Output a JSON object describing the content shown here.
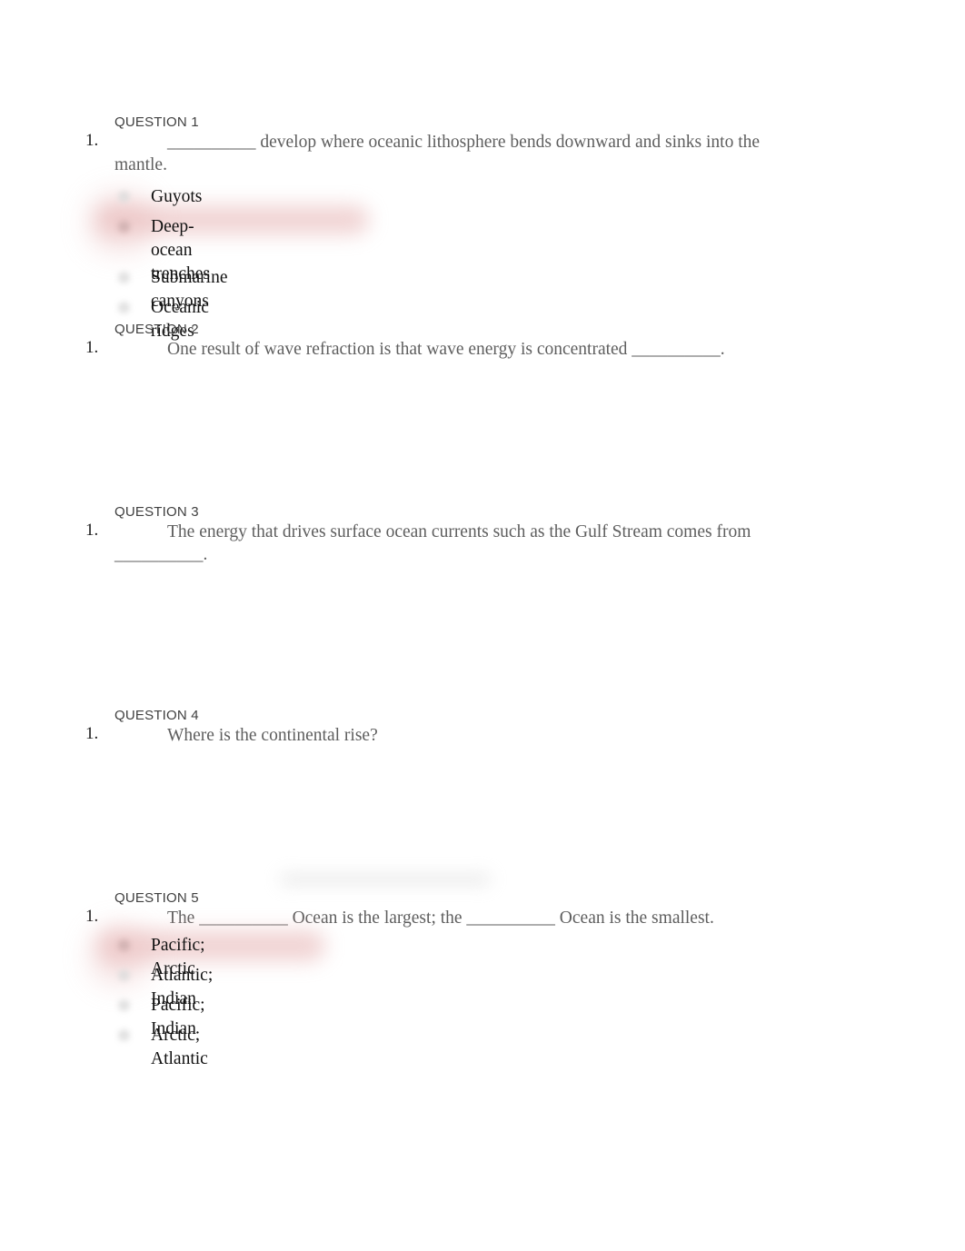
{
  "document": {
    "type": "quiz",
    "page_background": "#ffffff",
    "question_text_color": "#5e5e5e",
    "option_text_color": "#111111",
    "heading_color": "#3f3f3f",
    "highlight_color": "#e8b9b9"
  },
  "questions": [
    {
      "heading": "QUESTION 1",
      "number": "1.",
      "text": "__________ develop where oceanic lithosphere bends downward and sinks into the mantle.",
      "options": [
        {
          "label": "Guyots",
          "selected": false
        },
        {
          "label": "Deep-ocean\ntrenches",
          "selected": true
        },
        {
          "label": "Submarine canyons",
          "selected": false
        },
        {
          "label": "Oceanic ridges",
          "selected": false
        }
      ]
    },
    {
      "heading": "QUESTION 2",
      "number": "1.",
      "text": "One result of wave refraction is that wave energy is concentrated __________.",
      "options": []
    },
    {
      "heading": "QUESTION 3",
      "number": "1.",
      "text": "The energy that drives surface ocean currents such as the Gulf Stream comes from __________.",
      "options": []
    },
    {
      "heading": "QUESTION 4",
      "number": "1.",
      "text": "Where is the continental rise?",
      "options": []
    },
    {
      "heading": "QUESTION 5",
      "number": "1.",
      "text": "The __________ Ocean is the largest; the __________ Ocean is the smallest.",
      "options": [
        {
          "label": "Pacific; Arctic",
          "selected": true
        },
        {
          "label": "Atlantic; Indian",
          "selected": false
        },
        {
          "label": "Pacific; Indian",
          "selected": false
        },
        {
          "label": "Arctic; Atlantic",
          "selected": false
        }
      ]
    }
  ]
}
